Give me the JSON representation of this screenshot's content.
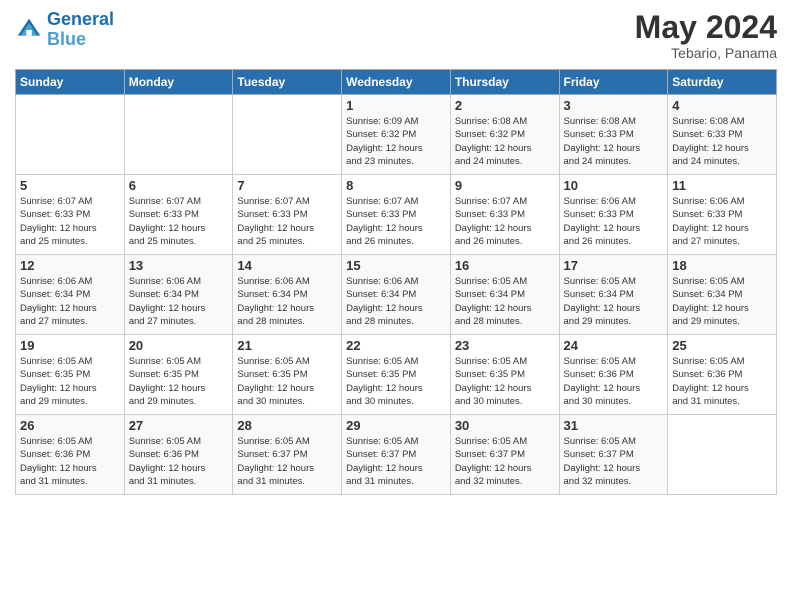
{
  "header": {
    "logo_line1": "General",
    "logo_line2": "Blue",
    "month": "May 2024",
    "location": "Tebario, Panama"
  },
  "days_of_week": [
    "Sunday",
    "Monday",
    "Tuesday",
    "Wednesday",
    "Thursday",
    "Friday",
    "Saturday"
  ],
  "weeks": [
    [
      {
        "day": "",
        "info": ""
      },
      {
        "day": "",
        "info": ""
      },
      {
        "day": "",
        "info": ""
      },
      {
        "day": "1",
        "info": "Sunrise: 6:09 AM\nSunset: 6:32 PM\nDaylight: 12 hours\nand 23 minutes."
      },
      {
        "day": "2",
        "info": "Sunrise: 6:08 AM\nSunset: 6:32 PM\nDaylight: 12 hours\nand 24 minutes."
      },
      {
        "day": "3",
        "info": "Sunrise: 6:08 AM\nSunset: 6:33 PM\nDaylight: 12 hours\nand 24 minutes."
      },
      {
        "day": "4",
        "info": "Sunrise: 6:08 AM\nSunset: 6:33 PM\nDaylight: 12 hours\nand 24 minutes."
      }
    ],
    [
      {
        "day": "5",
        "info": "Sunrise: 6:07 AM\nSunset: 6:33 PM\nDaylight: 12 hours\nand 25 minutes."
      },
      {
        "day": "6",
        "info": "Sunrise: 6:07 AM\nSunset: 6:33 PM\nDaylight: 12 hours\nand 25 minutes."
      },
      {
        "day": "7",
        "info": "Sunrise: 6:07 AM\nSunset: 6:33 PM\nDaylight: 12 hours\nand 25 minutes."
      },
      {
        "day": "8",
        "info": "Sunrise: 6:07 AM\nSunset: 6:33 PM\nDaylight: 12 hours\nand 26 minutes."
      },
      {
        "day": "9",
        "info": "Sunrise: 6:07 AM\nSunset: 6:33 PM\nDaylight: 12 hours\nand 26 minutes."
      },
      {
        "day": "10",
        "info": "Sunrise: 6:06 AM\nSunset: 6:33 PM\nDaylight: 12 hours\nand 26 minutes."
      },
      {
        "day": "11",
        "info": "Sunrise: 6:06 AM\nSunset: 6:33 PM\nDaylight: 12 hours\nand 27 minutes."
      }
    ],
    [
      {
        "day": "12",
        "info": "Sunrise: 6:06 AM\nSunset: 6:34 PM\nDaylight: 12 hours\nand 27 minutes."
      },
      {
        "day": "13",
        "info": "Sunrise: 6:06 AM\nSunset: 6:34 PM\nDaylight: 12 hours\nand 27 minutes."
      },
      {
        "day": "14",
        "info": "Sunrise: 6:06 AM\nSunset: 6:34 PM\nDaylight: 12 hours\nand 28 minutes."
      },
      {
        "day": "15",
        "info": "Sunrise: 6:06 AM\nSunset: 6:34 PM\nDaylight: 12 hours\nand 28 minutes."
      },
      {
        "day": "16",
        "info": "Sunrise: 6:05 AM\nSunset: 6:34 PM\nDaylight: 12 hours\nand 28 minutes."
      },
      {
        "day": "17",
        "info": "Sunrise: 6:05 AM\nSunset: 6:34 PM\nDaylight: 12 hours\nand 29 minutes."
      },
      {
        "day": "18",
        "info": "Sunrise: 6:05 AM\nSunset: 6:34 PM\nDaylight: 12 hours\nand 29 minutes."
      }
    ],
    [
      {
        "day": "19",
        "info": "Sunrise: 6:05 AM\nSunset: 6:35 PM\nDaylight: 12 hours\nand 29 minutes."
      },
      {
        "day": "20",
        "info": "Sunrise: 6:05 AM\nSunset: 6:35 PM\nDaylight: 12 hours\nand 29 minutes."
      },
      {
        "day": "21",
        "info": "Sunrise: 6:05 AM\nSunset: 6:35 PM\nDaylight: 12 hours\nand 30 minutes."
      },
      {
        "day": "22",
        "info": "Sunrise: 6:05 AM\nSunset: 6:35 PM\nDaylight: 12 hours\nand 30 minutes."
      },
      {
        "day": "23",
        "info": "Sunrise: 6:05 AM\nSunset: 6:35 PM\nDaylight: 12 hours\nand 30 minutes."
      },
      {
        "day": "24",
        "info": "Sunrise: 6:05 AM\nSunset: 6:36 PM\nDaylight: 12 hours\nand 30 minutes."
      },
      {
        "day": "25",
        "info": "Sunrise: 6:05 AM\nSunset: 6:36 PM\nDaylight: 12 hours\nand 31 minutes."
      }
    ],
    [
      {
        "day": "26",
        "info": "Sunrise: 6:05 AM\nSunset: 6:36 PM\nDaylight: 12 hours\nand 31 minutes."
      },
      {
        "day": "27",
        "info": "Sunrise: 6:05 AM\nSunset: 6:36 PM\nDaylight: 12 hours\nand 31 minutes."
      },
      {
        "day": "28",
        "info": "Sunrise: 6:05 AM\nSunset: 6:37 PM\nDaylight: 12 hours\nand 31 minutes."
      },
      {
        "day": "29",
        "info": "Sunrise: 6:05 AM\nSunset: 6:37 PM\nDaylight: 12 hours\nand 31 minutes."
      },
      {
        "day": "30",
        "info": "Sunrise: 6:05 AM\nSunset: 6:37 PM\nDaylight: 12 hours\nand 32 minutes."
      },
      {
        "day": "31",
        "info": "Sunrise: 6:05 AM\nSunset: 6:37 PM\nDaylight: 12 hours\nand 32 minutes."
      },
      {
        "day": "",
        "info": ""
      }
    ]
  ]
}
